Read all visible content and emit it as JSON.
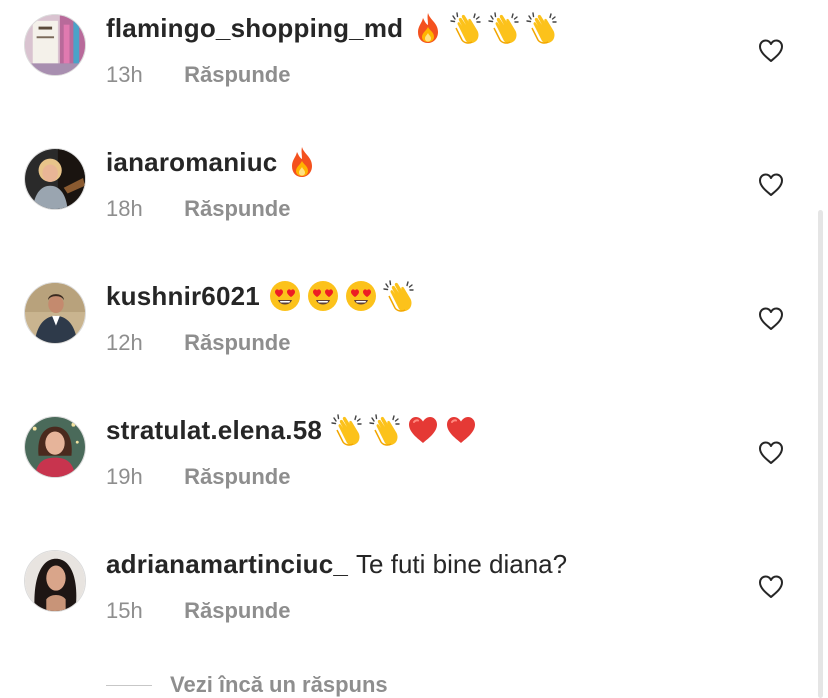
{
  "comments": [
    {
      "username": "flamingo_shopping_md",
      "text": "",
      "emojis": [
        "fire",
        "clap",
        "clap",
        "clap"
      ],
      "time": "13h",
      "reply_label": "Răspunde"
    },
    {
      "username": "ianaromaniuc",
      "text": "",
      "emojis": [
        "fire"
      ],
      "time": "18h",
      "reply_label": "Răspunde"
    },
    {
      "username": "kushnir6021",
      "text": "",
      "emojis": [
        "heart-eyes",
        "heart-eyes",
        "heart-eyes",
        "clap"
      ],
      "time": "12h",
      "reply_label": "Răspunde"
    },
    {
      "username": "stratulat.elena.58",
      "text": "",
      "emojis": [
        "clap",
        "clap",
        "red-heart",
        "red-heart"
      ],
      "time": "19h",
      "reply_label": "Răspunde"
    },
    {
      "username": "adrianamartinciuc_",
      "text": "Te futi bine diana?",
      "emojis": [],
      "time": "15h",
      "reply_label": "Răspunde"
    }
  ],
  "view_more_replies": "Vezi încă un răspuns",
  "colors": {
    "text": "#262626",
    "secondary": "#8e8e8e",
    "divider": "#c7c7c7"
  }
}
